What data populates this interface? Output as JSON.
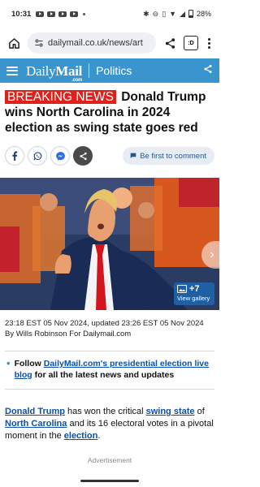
{
  "status_bar": {
    "time": "10:31",
    "battery": "28%"
  },
  "browser": {
    "url": "dailymail.co.uk/news/art",
    "tab_count": ":D"
  },
  "site": {
    "logo_daily": "Daily",
    "logo_mail": "Mail",
    "logo_com": ".com",
    "section": "Politics"
  },
  "article": {
    "breaking_label": "BREAKING NEWS",
    "headline": "Donald Trump wins North Carolina in 2024 election as swing state goes red",
    "comment_label": "Be first to comment",
    "gallery_count": "+7",
    "gallery_label": "View gallery",
    "dateline": "23:18 EST 05 Nov 2024, updated 23:26 EST 05 Nov 2024",
    "byline": "By Wills Robinson For Dailymail.com",
    "follow_prefix": "Follow ",
    "follow_link": "DailyMail.com's presidential election live blog",
    "follow_suffix": " for all the latest news and updates",
    "para_link1": "Donald Trump",
    "para_text1": " has won the critical ",
    "para_link2": "swing state",
    "para_text2": " of ",
    "para_link3": "North Carolina",
    "para_text3": " and its 16 electoral votes in a pivotal moment in the ",
    "para_link4": "election",
    "para_text4": ".",
    "advertisement": "Advertisement"
  },
  "colors": {
    "header_blue": "#3a95cf",
    "breaking_red": "#e0201b",
    "link_blue": "#0c4fa7"
  }
}
